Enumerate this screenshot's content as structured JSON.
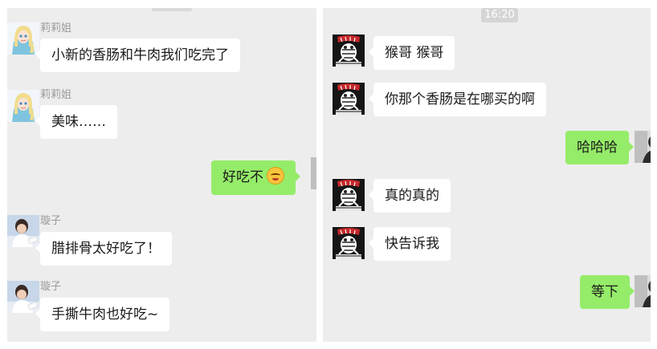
{
  "left_chat": {
    "messages": [
      {
        "sender": "莉莉姐",
        "text": "小新的香肠和牛肉我们吃完了",
        "avatar_icon": "elsa-avatar-icon"
      },
      {
        "sender": "莉莉姐",
        "text": "美味……",
        "avatar_icon": "elsa-avatar-icon"
      },
      {
        "sender": "",
        "text": "好吃不",
        "emoji": "smiling-face-emoji-icon",
        "outgoing": true
      },
      {
        "sender": "璇子",
        "text": "腊排骨太好吃了！",
        "avatar_icon": "photo-avatar-icon"
      },
      {
        "sender": "璇子",
        "text": "手撕牛肉也好吃~",
        "avatar_icon": "photo-avatar-icon"
      }
    ]
  },
  "right_chat": {
    "timestamp": "16:20",
    "messages": [
      {
        "text": "猴哥 猴哥",
        "avatar_icon": "comic-avatar-icon"
      },
      {
        "text": "你那个香肠是在哪买的啊",
        "avatar_icon": "comic-avatar-icon"
      },
      {
        "text": "哈哈哈",
        "outgoing": true
      },
      {
        "text": "真的真的",
        "avatar_icon": "comic-avatar-icon"
      },
      {
        "text": "快告诉我",
        "avatar_icon": "comic-avatar-icon"
      },
      {
        "text": "等下",
        "outgoing": true
      }
    ]
  },
  "colors": {
    "chat_background": "#ededed",
    "incoming_bubble": "#ffffff",
    "outgoing_bubble": "#95ec69",
    "sender_name": "#9a9a9a"
  }
}
